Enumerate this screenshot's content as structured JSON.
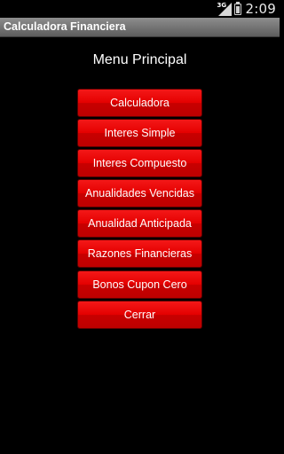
{
  "status_bar": {
    "network_type": "3G",
    "time": "2:09"
  },
  "app": {
    "title": "Calculadora Financiera"
  },
  "main": {
    "heading": "Menu Principal",
    "buttons": [
      "Calculadora",
      "Interes Simple",
      "Interes Compuesto",
      "Anualidades Vencidas",
      "Anualidad Anticipada",
      "Razones Financieras",
      "Bonos Cupon Cero",
      "Cerrar"
    ]
  },
  "colors": {
    "button_red": "#e00000",
    "background": "#000000",
    "title_bar": "#7a7a7a"
  }
}
